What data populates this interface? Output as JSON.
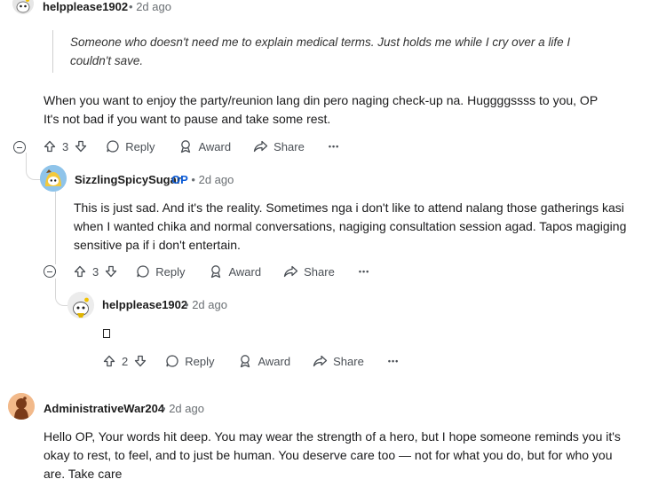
{
  "comments": [
    {
      "username": "helpplease1902",
      "timestamp": "2d ago",
      "quote": "Someone who doesn't need me to explain medical terms. Just holds me while I cry over a life I couldn't save.",
      "body_lines": [
        "When you want to enjoy the party/reunion lang din pero naging check-up na. Huggggssss to you, OP",
        "It's not bad if you want to pause and take some rest."
      ],
      "votes": "3",
      "reply_label": "Reply",
      "award_label": "Award",
      "share_label": "Share",
      "more_label": "•••"
    },
    {
      "username": "SizzlingSpicySugar",
      "op_badge": "OP",
      "timestamp": "2d ago",
      "body_lines": [
        "This is just sad. And it's the reality. Sometimes nga i don't like to attend nalang those gatherings kasi",
        "when I wanted chika and normal conversations, nagiging consultation session agad. Tapos magiging",
        "sensitive pa if i don't entertain."
      ],
      "votes": "3",
      "reply_label": "Reply",
      "award_label": "Award",
      "share_label": "Share",
      "more_label": "•••"
    },
    {
      "username": "helpplease1902",
      "timestamp": "2d ago",
      "votes": "2",
      "reply_label": "Reply",
      "award_label": "Award",
      "share_label": "Share",
      "more_label": "•••"
    },
    {
      "username": "AdministrativeWar204",
      "timestamp": "2d ago",
      "body_lines": [
        "Hello OP, Your words hit deep. You may wear the strength of a hero, but I hope someone reminds you it's",
        "okay to rest, to feel, and to just be human. You deserve care too — not for what you do, but for who you",
        "are. Take care"
      ]
    }
  ],
  "separator": "•",
  "colors": {
    "op_badge": "#0a5ad6",
    "meta": "#6a6f73",
    "thread_line": "#d7d7d7"
  }
}
